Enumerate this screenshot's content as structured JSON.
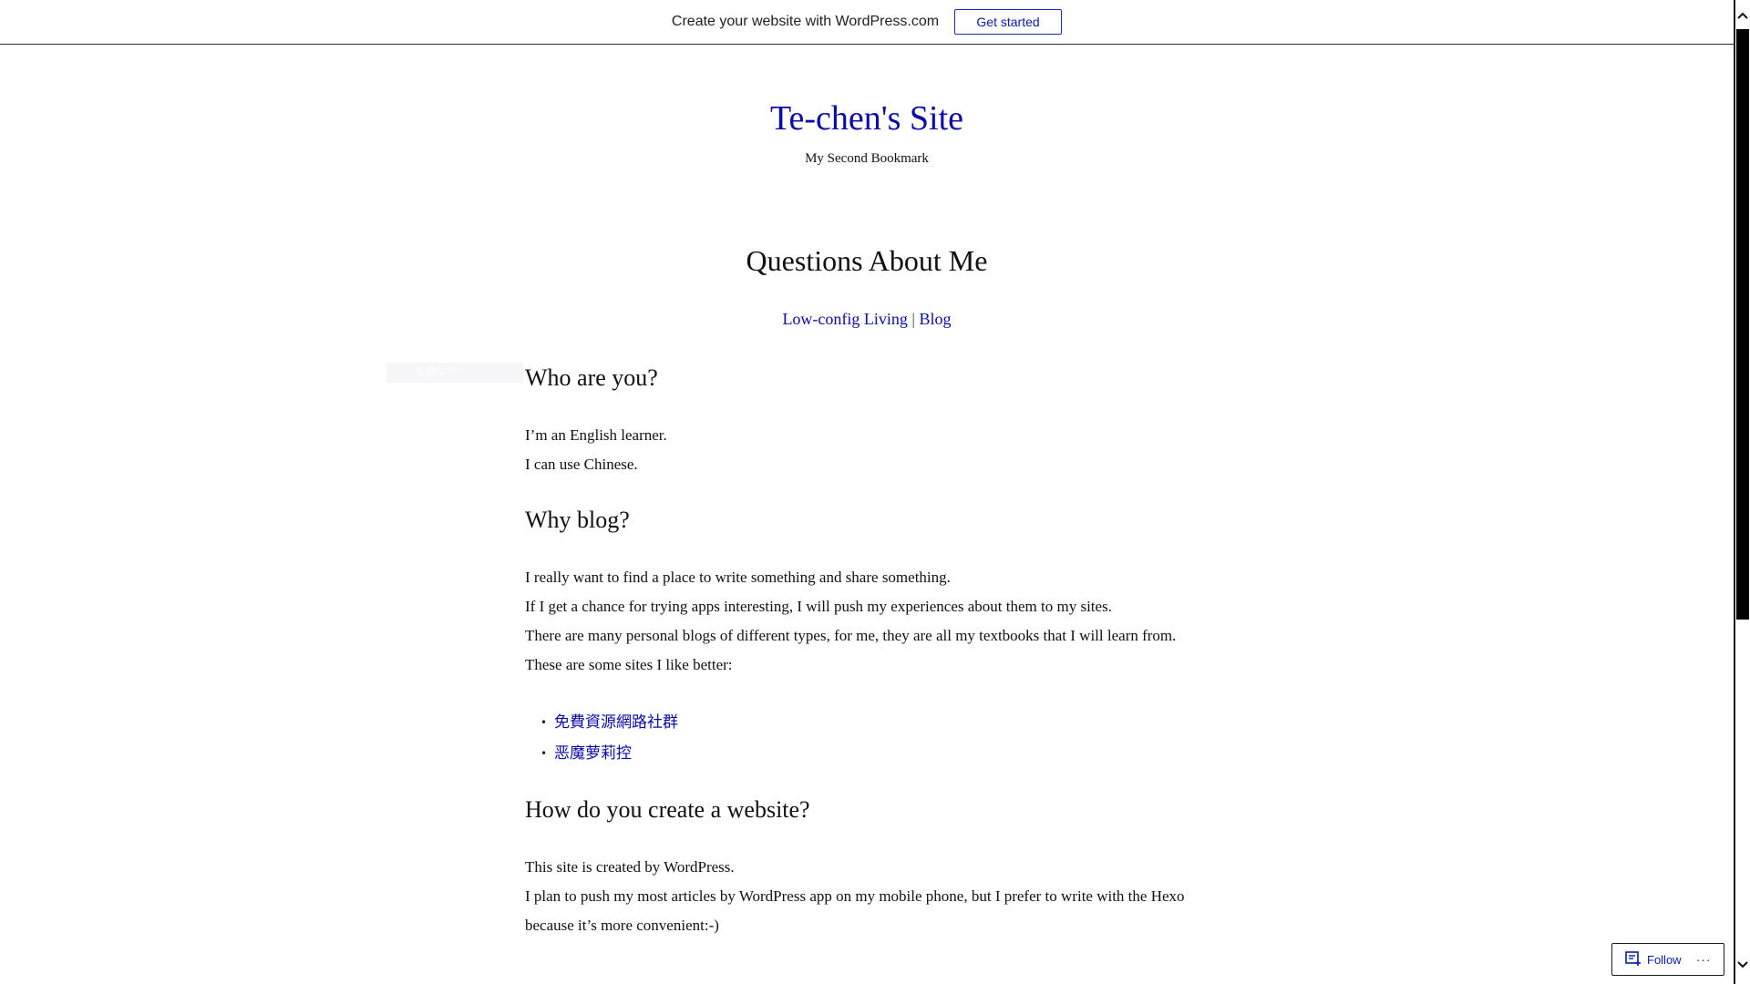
{
  "banner": {
    "text": "Create your website with WordPress.com",
    "button_label": "Get started"
  },
  "header": {
    "site_title": "Te-chen's Site",
    "tagline": "My Second Bookmark"
  },
  "page": {
    "title": "Questions About Me",
    "links": [
      {
        "label": "Low-config Living"
      },
      {
        "label": "Blog"
      }
    ],
    "link_separator": "|"
  },
  "side_widget": {
    "text": "繁體中文"
  },
  "sections": [
    {
      "heading": "Who are you?",
      "lines": [
        "I’m an English learner.",
        "I can use Chinese."
      ]
    },
    {
      "heading": "Why blog?",
      "lines": [
        "I really want to find a place to write something and share something.",
        "If I get a chance for trying apps interesting, I will push my experiences about them to my sites.",
        "There are many personal blogs of different types, for me, they are all my textbooks that I will learn from.",
        "These are some sites I like better:"
      ],
      "list": [
        "免費資源網路社群",
        "恶魔萝莉控"
      ]
    },
    {
      "heading": "How do you create a website?",
      "lines": [
        "This site is created by WordPress.",
        "I plan to push my most articles by WordPress app on my mobile phone, but I prefer to write with the Hexo because it’s more convenient:-)"
      ]
    }
  ],
  "follow": {
    "label": "Follow",
    "more_label": "···"
  },
  "colors": {
    "link": "#0a0aa8",
    "text": "#111111",
    "border": "#2c2c2c"
  },
  "icons": {
    "follow": "follow-reader-icon",
    "scroll_up": "chevron-up-icon",
    "scroll_down": "chevron-down-icon"
  }
}
